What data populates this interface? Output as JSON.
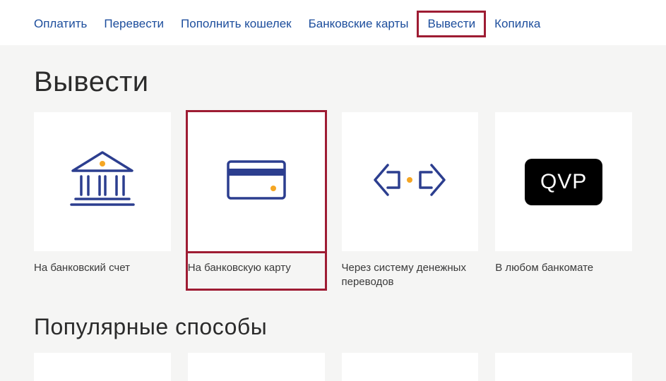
{
  "nav": {
    "items": [
      {
        "label": "Оплатить"
      },
      {
        "label": "Перевести"
      },
      {
        "label": "Пополнить кошелек"
      },
      {
        "label": "Банковские карты"
      },
      {
        "label": "Вывести"
      },
      {
        "label": "Копилка"
      }
    ]
  },
  "page_title": "Вывести",
  "withdraw_options": {
    "items": [
      {
        "label": "На банковский счет",
        "icon": "bank-icon"
      },
      {
        "label": "На банковскую карту",
        "icon": "card-icon"
      },
      {
        "label": "Через систему денежных переводов",
        "icon": "transfer-arrows-icon"
      },
      {
        "label": "В любом банкомате",
        "icon": "qvp-icon",
        "icon_text": "QVP"
      }
    ]
  },
  "popular_title": "Популярные способы",
  "colors": {
    "nav_link": "#1c4d9c",
    "highlight": "#9e1c33",
    "accent": "#f5a623",
    "icon_stroke": "#2c3e8f"
  }
}
